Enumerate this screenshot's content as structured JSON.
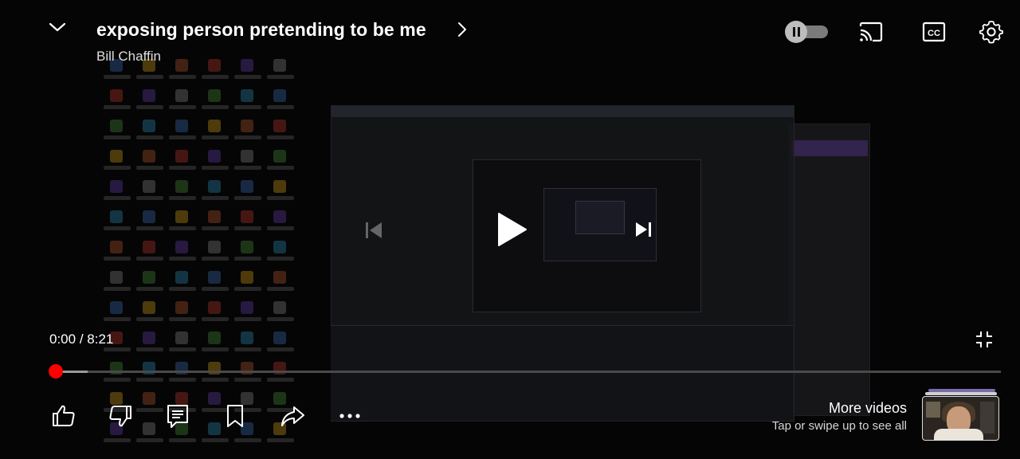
{
  "video": {
    "title": "exposing person pretending to be me",
    "channel": "Bill Chaffin"
  },
  "player": {
    "current_time": "0:00",
    "separator": "/",
    "duration": "8:21",
    "progress_fraction": 0.0,
    "accent_color": "#ff0000",
    "state": "paused",
    "autoplay": "paused-toggle"
  },
  "top_icons": [
    "chevron-down-icon",
    "autoplay-toggle",
    "cast-icon",
    "cc-icon",
    "gear-icon"
  ],
  "center_icons": [
    "previous-icon",
    "play-icon",
    "next-icon"
  ],
  "action_icons": [
    "thumbs-up-icon",
    "thumbs-down-icon",
    "comments-icon",
    "save-icon",
    "share-icon",
    "more-icon"
  ],
  "more_videos": {
    "title": "More videos",
    "subtitle": "Tap or swipe up to see all"
  }
}
